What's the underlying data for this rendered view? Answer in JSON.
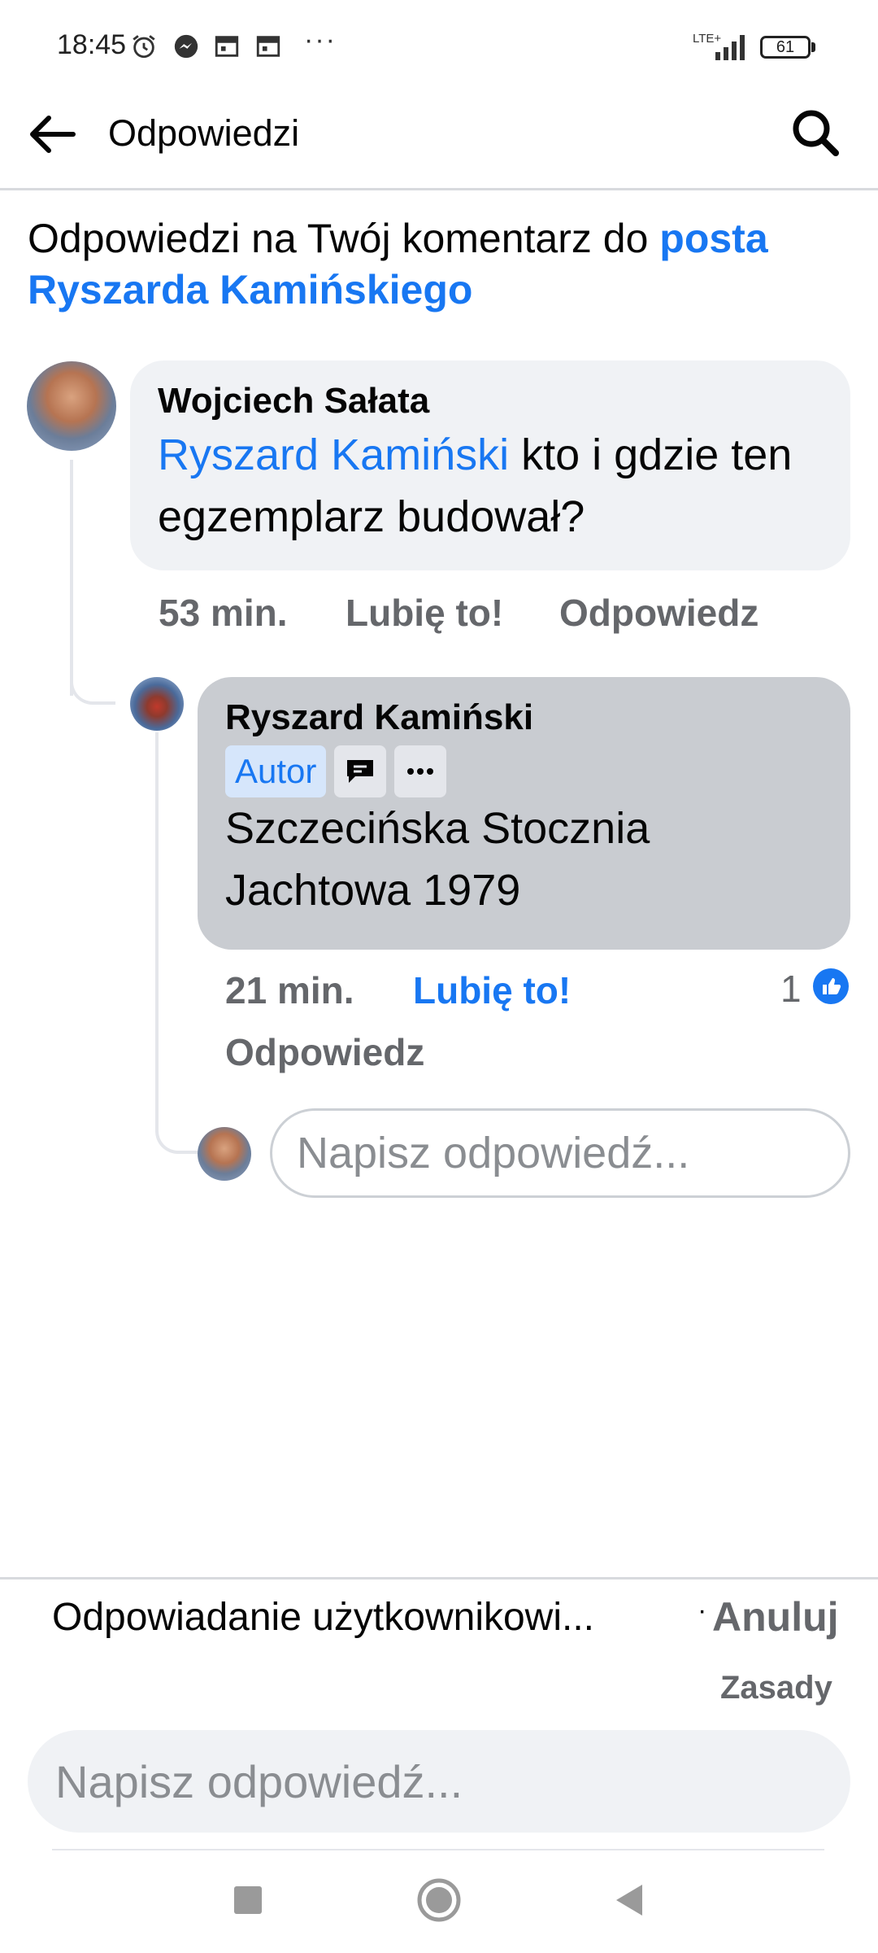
{
  "status_bar": {
    "time": "18:45",
    "icons": [
      "alarm-icon",
      "messenger-icon",
      "calendar-icon",
      "calendar-icon"
    ],
    "more": "···",
    "network": "LTE+",
    "battery": "61"
  },
  "top_bar": {
    "title": "Odpowiedzi",
    "back_icon": "arrow-left-icon",
    "search_icon": "search-icon"
  },
  "header": {
    "text": "Odpowiedzi na Twój komentarz do ",
    "link": "posta Ryszarda Kamińskiego"
  },
  "comments": [
    {
      "author": "Wojciech Sałata",
      "mention": "Ryszard Kamiński",
      "text": " kto i gdzie ten egzemplarz budował?",
      "time": "53 min.",
      "like_label": "Lubię to!",
      "reply_label": "Odpowiedz"
    },
    {
      "author": "Ryszard Kamiński",
      "badge": "Autor",
      "text": "Szczecińska Stocznia Jachtowa 1979",
      "time": "21 min.",
      "like_label": "Lubię to!",
      "liked": true,
      "reply_label": "Odpowiedz",
      "reaction_count": "1"
    }
  ],
  "reply_placeholder": "Napisz odpowiedź...",
  "composer": {
    "replying_to": "Odpowiadanie użytkownikowi...",
    "separator": "·",
    "cancel": "Anuluj",
    "rules": "Zasady",
    "placeholder": "Napisz odpowiedź..."
  },
  "colors": {
    "link": "#1877f2",
    "bubble": "#f0f2f5",
    "bubble_selected": "#c9ccd1",
    "meta": "#65676b"
  }
}
